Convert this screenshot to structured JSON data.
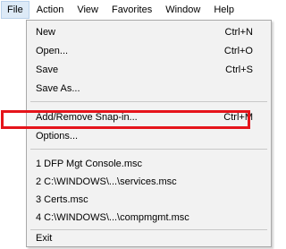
{
  "menubar": {
    "items": [
      "File",
      "Action",
      "View",
      "Favorites",
      "Window",
      "Help"
    ]
  },
  "file_menu": {
    "new": {
      "label": "New",
      "shortcut": "Ctrl+N"
    },
    "open": {
      "label": "Open...",
      "shortcut": "Ctrl+O"
    },
    "save": {
      "label": "Save",
      "shortcut": "Ctrl+S"
    },
    "save_as": {
      "label": "Save As..."
    },
    "add_remove": {
      "label": "Add/Remove Snap-in...",
      "shortcut": "Ctrl+M"
    },
    "options": {
      "label": "Options..."
    },
    "recent": [
      "1 DFP Mgt Console.msc",
      "2 C:\\WINDOWS\\...\\services.msc",
      "3 Certs.msc",
      "4 C:\\WINDOWS\\...\\compmgmt.msc"
    ],
    "exit": {
      "label": "Exit"
    }
  },
  "highlight_color": "#e5141b"
}
